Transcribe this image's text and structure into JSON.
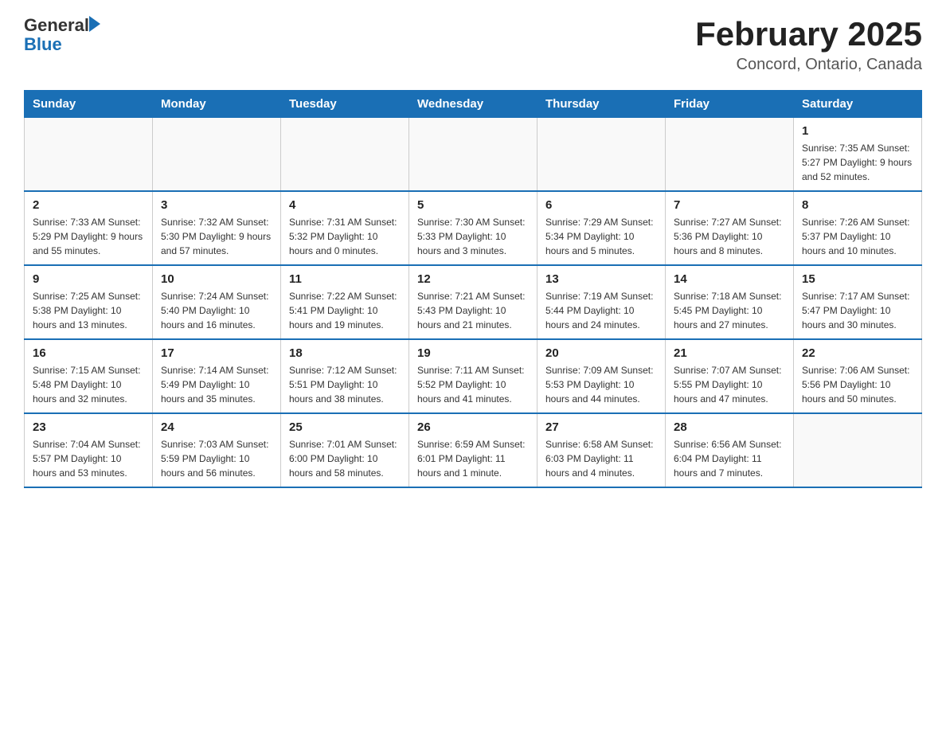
{
  "header": {
    "logo_general": "General",
    "logo_blue": "Blue",
    "title": "February 2025",
    "subtitle": "Concord, Ontario, Canada"
  },
  "weekdays": [
    "Sunday",
    "Monday",
    "Tuesday",
    "Wednesday",
    "Thursday",
    "Friday",
    "Saturday"
  ],
  "weeks": [
    [
      {
        "day": "",
        "info": ""
      },
      {
        "day": "",
        "info": ""
      },
      {
        "day": "",
        "info": ""
      },
      {
        "day": "",
        "info": ""
      },
      {
        "day": "",
        "info": ""
      },
      {
        "day": "",
        "info": ""
      },
      {
        "day": "1",
        "info": "Sunrise: 7:35 AM\nSunset: 5:27 PM\nDaylight: 9 hours and 52 minutes."
      }
    ],
    [
      {
        "day": "2",
        "info": "Sunrise: 7:33 AM\nSunset: 5:29 PM\nDaylight: 9 hours and 55 minutes."
      },
      {
        "day": "3",
        "info": "Sunrise: 7:32 AM\nSunset: 5:30 PM\nDaylight: 9 hours and 57 minutes."
      },
      {
        "day": "4",
        "info": "Sunrise: 7:31 AM\nSunset: 5:32 PM\nDaylight: 10 hours and 0 minutes."
      },
      {
        "day": "5",
        "info": "Sunrise: 7:30 AM\nSunset: 5:33 PM\nDaylight: 10 hours and 3 minutes."
      },
      {
        "day": "6",
        "info": "Sunrise: 7:29 AM\nSunset: 5:34 PM\nDaylight: 10 hours and 5 minutes."
      },
      {
        "day": "7",
        "info": "Sunrise: 7:27 AM\nSunset: 5:36 PM\nDaylight: 10 hours and 8 minutes."
      },
      {
        "day": "8",
        "info": "Sunrise: 7:26 AM\nSunset: 5:37 PM\nDaylight: 10 hours and 10 minutes."
      }
    ],
    [
      {
        "day": "9",
        "info": "Sunrise: 7:25 AM\nSunset: 5:38 PM\nDaylight: 10 hours and 13 minutes."
      },
      {
        "day": "10",
        "info": "Sunrise: 7:24 AM\nSunset: 5:40 PM\nDaylight: 10 hours and 16 minutes."
      },
      {
        "day": "11",
        "info": "Sunrise: 7:22 AM\nSunset: 5:41 PM\nDaylight: 10 hours and 19 minutes."
      },
      {
        "day": "12",
        "info": "Sunrise: 7:21 AM\nSunset: 5:43 PM\nDaylight: 10 hours and 21 minutes."
      },
      {
        "day": "13",
        "info": "Sunrise: 7:19 AM\nSunset: 5:44 PM\nDaylight: 10 hours and 24 minutes."
      },
      {
        "day": "14",
        "info": "Sunrise: 7:18 AM\nSunset: 5:45 PM\nDaylight: 10 hours and 27 minutes."
      },
      {
        "day": "15",
        "info": "Sunrise: 7:17 AM\nSunset: 5:47 PM\nDaylight: 10 hours and 30 minutes."
      }
    ],
    [
      {
        "day": "16",
        "info": "Sunrise: 7:15 AM\nSunset: 5:48 PM\nDaylight: 10 hours and 32 minutes."
      },
      {
        "day": "17",
        "info": "Sunrise: 7:14 AM\nSunset: 5:49 PM\nDaylight: 10 hours and 35 minutes."
      },
      {
        "day": "18",
        "info": "Sunrise: 7:12 AM\nSunset: 5:51 PM\nDaylight: 10 hours and 38 minutes."
      },
      {
        "day": "19",
        "info": "Sunrise: 7:11 AM\nSunset: 5:52 PM\nDaylight: 10 hours and 41 minutes."
      },
      {
        "day": "20",
        "info": "Sunrise: 7:09 AM\nSunset: 5:53 PM\nDaylight: 10 hours and 44 minutes."
      },
      {
        "day": "21",
        "info": "Sunrise: 7:07 AM\nSunset: 5:55 PM\nDaylight: 10 hours and 47 minutes."
      },
      {
        "day": "22",
        "info": "Sunrise: 7:06 AM\nSunset: 5:56 PM\nDaylight: 10 hours and 50 minutes."
      }
    ],
    [
      {
        "day": "23",
        "info": "Sunrise: 7:04 AM\nSunset: 5:57 PM\nDaylight: 10 hours and 53 minutes."
      },
      {
        "day": "24",
        "info": "Sunrise: 7:03 AM\nSunset: 5:59 PM\nDaylight: 10 hours and 56 minutes."
      },
      {
        "day": "25",
        "info": "Sunrise: 7:01 AM\nSunset: 6:00 PM\nDaylight: 10 hours and 58 minutes."
      },
      {
        "day": "26",
        "info": "Sunrise: 6:59 AM\nSunset: 6:01 PM\nDaylight: 11 hours and 1 minute."
      },
      {
        "day": "27",
        "info": "Sunrise: 6:58 AM\nSunset: 6:03 PM\nDaylight: 11 hours and 4 minutes."
      },
      {
        "day": "28",
        "info": "Sunrise: 6:56 AM\nSunset: 6:04 PM\nDaylight: 11 hours and 7 minutes."
      },
      {
        "day": "",
        "info": ""
      }
    ]
  ]
}
